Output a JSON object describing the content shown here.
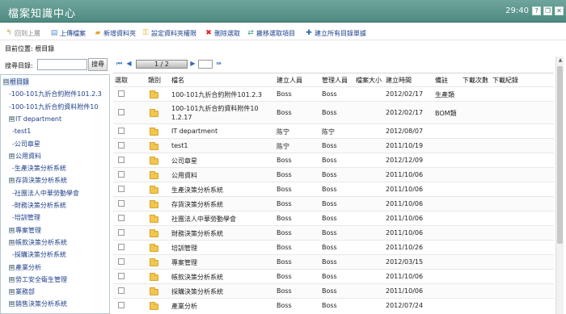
{
  "window": {
    "title": "檔案知識中心",
    "clock": "29:40",
    "help_label": "?",
    "restore_label": "❐",
    "close_label": "✕"
  },
  "toolbar": {
    "back_label": "回到上層",
    "upload_label": "上傳檔案",
    "new_folder_label": "新增資料夾",
    "permission_label": "設定資料夾權限",
    "delete_label": "刪除選取",
    "move_label": "搬移選取項目",
    "build_index_label": "建立所有目錄單據"
  },
  "breadcrumb": "目前位置: 根目錄",
  "sidebar": {
    "search_label": "搜尋目錄:",
    "search_value": "",
    "search_button": "搜尋",
    "tree": [
      {
        "label": "根目錄",
        "toggle": "⊟"
      },
      {
        "label": "-100-101九折合約附件101.2.3",
        "toggle": ""
      },
      {
        "label": "-100-101九折合約資料附件10",
        "toggle": ""
      },
      {
        "label": "IT department",
        "toggle": "⊞"
      },
      {
        "label": "-test1",
        "toggle": ""
      },
      {
        "label": "-公司章星",
        "toggle": ""
      },
      {
        "label": "公用資料",
        "toggle": "⊞"
      },
      {
        "label": "-生產決策分析系統",
        "toggle": ""
      },
      {
        "label": "存貨決策分析系統",
        "toggle": "⊞"
      },
      {
        "label": "-社團法人中華勞動學會",
        "toggle": ""
      },
      {
        "label": "-財務決策分析系統",
        "toggle": ""
      },
      {
        "label": "-培訓管理",
        "toggle": ""
      },
      {
        "label": "專案管理",
        "toggle": "⊞"
      },
      {
        "label": "帳款決策分析系統",
        "toggle": "⊞"
      },
      {
        "label": "-採購決策分析系統",
        "toggle": ""
      },
      {
        "label": "產業分析",
        "toggle": "⊞"
      },
      {
        "label": "勞工安全衛生管理",
        "toggle": "⊞"
      },
      {
        "label": "業務部",
        "toggle": "⊞"
      },
      {
        "label": "銷售決策分析系統",
        "toggle": "⊞"
      }
    ]
  },
  "pager": {
    "first": "⏮",
    "prev": "◀",
    "page_text": "1 / 2",
    "next": "▶",
    "last": "⏭",
    "go": "⇛"
  },
  "table": {
    "headers": [
      "選取",
      "類別",
      "檔名",
      "建立人員",
      "管理人員",
      "檔案大小",
      "建立時間",
      "備註",
      "下載次數",
      "下載紀錄"
    ],
    "rows": [
      {
        "name": "100-101九折合約附件101.2.3",
        "name2": "",
        "creator": "Boss",
        "manager": "Boss",
        "date": "2012/02/17",
        "note": "生產類"
      },
      {
        "name": "100-101九折合約資料附件10",
        "name2": "1.2.17",
        "creator": "Boss",
        "manager": "Boss",
        "date": "2012/02/17",
        "note": "BOM類"
      },
      {
        "name": "IT department",
        "name2": "",
        "creator": "陈宁",
        "manager": "陈宁",
        "date": "2012/08/07",
        "note": ""
      },
      {
        "name": "test1",
        "name2": "",
        "creator": "陈宁",
        "manager": "Boss",
        "date": "2011/10/19",
        "note": ""
      },
      {
        "name": "公司章星",
        "name2": "",
        "creator": "Boss",
        "manager": "Boss",
        "date": "2012/12/09",
        "note": ""
      },
      {
        "name": "公用資料",
        "name2": "",
        "creator": "Boss",
        "manager": "Boss",
        "date": "2011/10/06",
        "note": ""
      },
      {
        "name": "生產決策分析系統",
        "name2": "",
        "creator": "Boss",
        "manager": "Boss",
        "date": "2011/10/06",
        "note": ""
      },
      {
        "name": "存貨決策分析系統",
        "name2": "",
        "creator": "Boss",
        "manager": "Boss",
        "date": "2011/10/06",
        "note": ""
      },
      {
        "name": "社團法人中華勞動學會",
        "name2": "",
        "creator": "Boss",
        "manager": "Boss",
        "date": "2011/10/06",
        "note": ""
      },
      {
        "name": "財務決策分析系統",
        "name2": "",
        "creator": "Boss",
        "manager": "Boss",
        "date": "2011/10/06",
        "note": ""
      },
      {
        "name": "培訓管理",
        "name2": "",
        "creator": "Boss",
        "manager": "Boss",
        "date": "2011/10/26",
        "note": ""
      },
      {
        "name": "專案管理",
        "name2": "",
        "creator": "Boss",
        "manager": "Boss",
        "date": "2012/03/15",
        "note": ""
      },
      {
        "name": "帳款決策分析系統",
        "name2": "",
        "creator": "Boss",
        "manager": "Boss",
        "date": "2011/10/06",
        "note": ""
      },
      {
        "name": "採購決策分析系統",
        "name2": "",
        "creator": "Boss",
        "manager": "Boss",
        "date": "2011/10/06",
        "note": ""
      },
      {
        "name": "產業分析",
        "name2": "",
        "creator": "Boss",
        "manager": "Boss",
        "date": "2012/07/24",
        "note": ""
      }
    ]
  }
}
